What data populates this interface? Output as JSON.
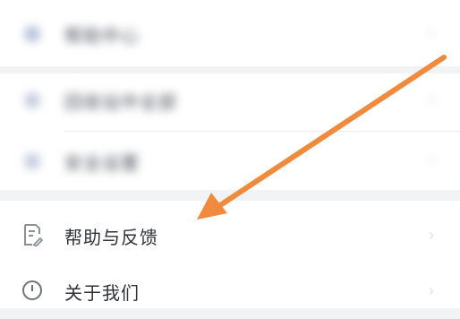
{
  "menu": {
    "blurred_items": [
      {
        "label": "帮助中心",
        "icon": "blurred-icon"
      },
      {
        "label": "回收站中全部",
        "icon": "blurred-icon"
      },
      {
        "label": "安全设置",
        "icon": "blurred-icon"
      }
    ],
    "help_feedback": {
      "label": "帮助与反馈",
      "icon": "document-edit-icon"
    },
    "about_us": {
      "label": "关于我们",
      "icon": "info-circle-icon"
    }
  },
  "annotation": {
    "arrow_color": "#f08a3c"
  },
  "colors": {
    "background": "#f2f3f5",
    "card": "#ffffff",
    "text": "#2f3238"
  }
}
